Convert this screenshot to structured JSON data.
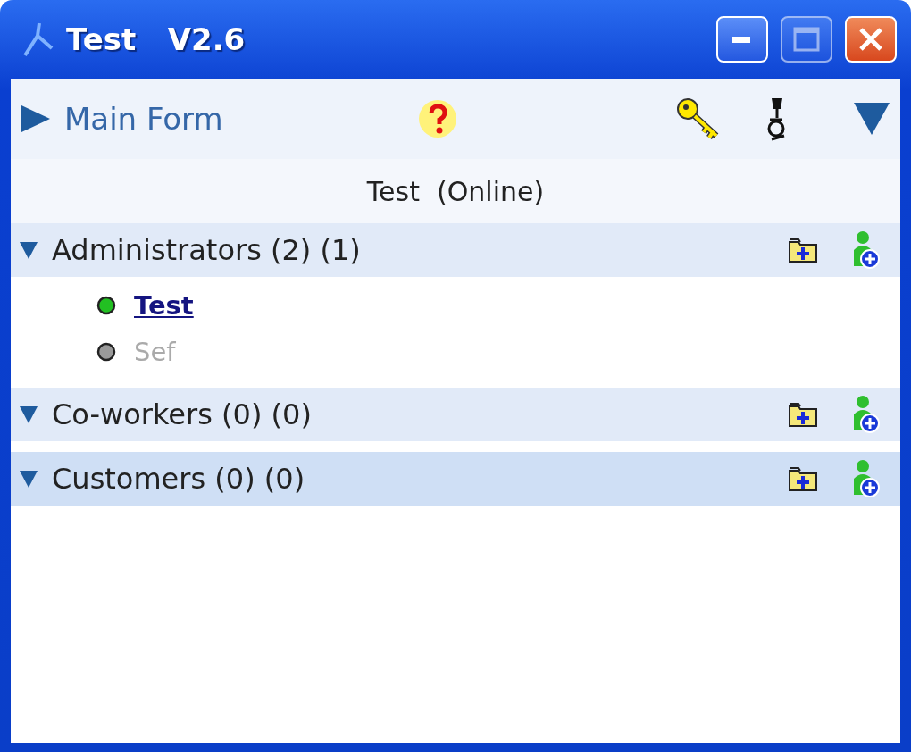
{
  "window": {
    "title": "Test   V2.6"
  },
  "toolbar": {
    "title": "Main Form"
  },
  "status": "Test  (Online)",
  "groups": [
    {
      "name": "Administrators (2) (1)",
      "expanded": true,
      "selected": false,
      "members": [
        {
          "name": "Test",
          "online": true
        },
        {
          "name": "Sef",
          "online": false
        }
      ]
    },
    {
      "name": "Co-workers (0) (0)",
      "expanded": true,
      "selected": false
    },
    {
      "name": "Customers (0) (0)",
      "expanded": true,
      "selected": true
    }
  ]
}
